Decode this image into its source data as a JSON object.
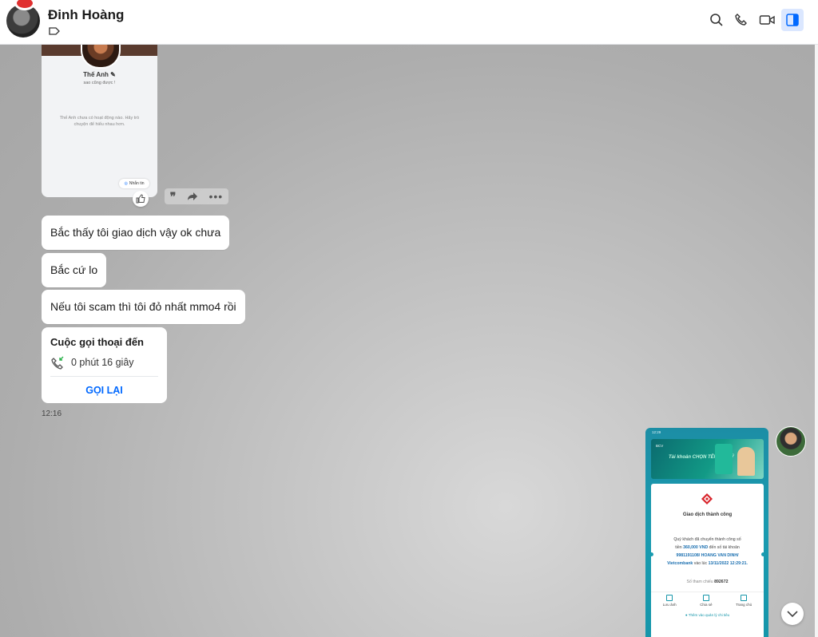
{
  "header": {
    "contact_name": "Đinh Hoàng"
  },
  "profile_card": {
    "name": "Thế Anh",
    "status": "sao cũng được !",
    "empty_text": "Thế Anh chưa có hoạt động nào. Hãy trò chuyện để hiểu nhau hơn.",
    "message_button": "Nhắn tin"
  },
  "messages": [
    {
      "text": "Bắc thấy tôi giao dịch vậy ok chưa"
    },
    {
      "text": "Bắc cứ lo"
    },
    {
      "text": "Nếu tôi scam thì tôi đỏ nhất mmo4 rồi"
    }
  ],
  "call_card": {
    "title": "Cuộc gọi thoại đến",
    "duration": "0 phút 16 giây",
    "call_back": "GỌI LẠI"
  },
  "timestamp": "12:16",
  "receipt": {
    "status_time": "12:29",
    "bank_short": "BCV",
    "banner_text": "Tài khoản CHỌN TÊN NHƯ Ý",
    "success": "Giao dịch thành công",
    "line1": "Quý khách đã chuyển thành công số",
    "line2_pre": "tiền",
    "amount": "360,000 VND",
    "line2_post": "đến số tài khoản",
    "account": "9981191108/ HOANG VAN DINH/",
    "bank": "Vietcombank",
    "line4_mid": "vào lúc",
    "datetime": "13/11/2022 12:29:21.",
    "ref_label": "Số tham chiếu",
    "ref_value": "892672",
    "actions": [
      "Lưu ảnh",
      "Chia sẻ",
      "Trang chủ"
    ],
    "more": "Thêm vào quản lý chi tiêu"
  },
  "colors": {
    "accent": "#0068ff",
    "bubble": "#ffffff",
    "receipt_teal": "#1596aa"
  }
}
